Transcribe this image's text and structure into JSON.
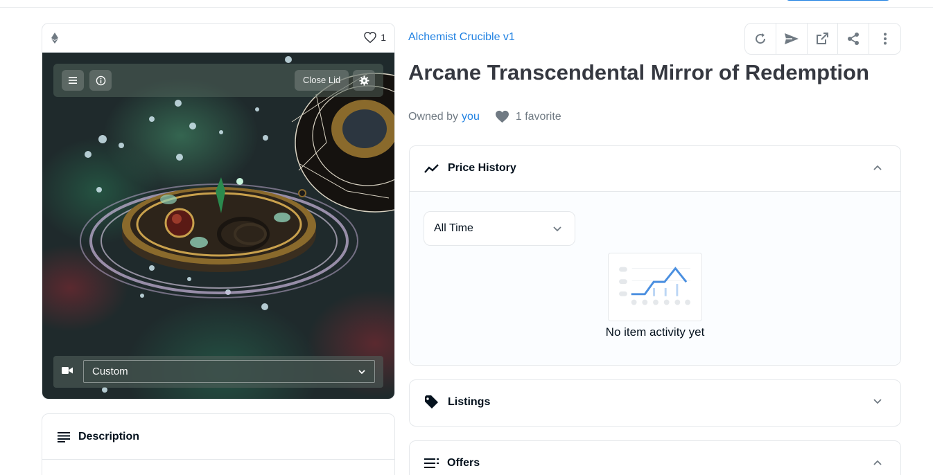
{
  "media": {
    "favorite_count": "1",
    "close_lid_label": "Close Lid",
    "camera_preset": "Custom"
  },
  "description": {
    "title": "Description"
  },
  "item": {
    "collection": "Alchemist Crucible v1",
    "title": "Arcane Transcendental Mirror of Redemption",
    "owned_by_label": "Owned by",
    "owner": "you",
    "favorites": "1 favorite"
  },
  "price_history": {
    "title": "Price History",
    "range": "All Time",
    "empty_message": "No item activity yet"
  },
  "listings": {
    "title": "Listings"
  },
  "offers": {
    "title": "Offers"
  },
  "colors": {
    "accent": "#2081e2",
    "text": "#04111d",
    "muted": "#707a83",
    "border": "#e5e8eb"
  }
}
